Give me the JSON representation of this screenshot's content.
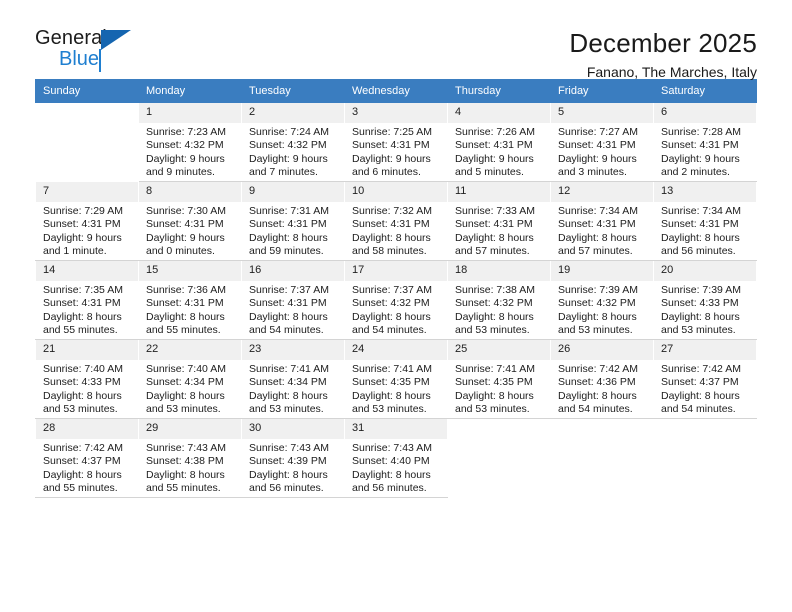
{
  "brand": {
    "name_top": "General",
    "name_bottom": "Blue",
    "accent_color": "#1f7fd0",
    "triangle_color": "#1565b0"
  },
  "header": {
    "title": "December 2025",
    "subtitle": "Fanano, The Marches, Italy"
  },
  "calendar": {
    "header_bg": "#3a7dc0",
    "header_text_color": "#ffffff",
    "daynum_bg": "#f0f0f0",
    "weekday_headers": [
      "Sunday",
      "Monday",
      "Tuesday",
      "Wednesday",
      "Thursday",
      "Friday",
      "Saturday"
    ],
    "weeks": [
      [
        {
          "day": "",
          "lines": []
        },
        {
          "day": "1",
          "lines": [
            "Sunrise: 7:23 AM",
            "Sunset: 4:32 PM",
            "Daylight: 9 hours",
            "and 9 minutes."
          ]
        },
        {
          "day": "2",
          "lines": [
            "Sunrise: 7:24 AM",
            "Sunset: 4:32 PM",
            "Daylight: 9 hours",
            "and 7 minutes."
          ]
        },
        {
          "day": "3",
          "lines": [
            "Sunrise: 7:25 AM",
            "Sunset: 4:31 PM",
            "Daylight: 9 hours",
            "and 6 minutes."
          ]
        },
        {
          "day": "4",
          "lines": [
            "Sunrise: 7:26 AM",
            "Sunset: 4:31 PM",
            "Daylight: 9 hours",
            "and 5 minutes."
          ]
        },
        {
          "day": "5",
          "lines": [
            "Sunrise: 7:27 AM",
            "Sunset: 4:31 PM",
            "Daylight: 9 hours",
            "and 3 minutes."
          ]
        },
        {
          "day": "6",
          "lines": [
            "Sunrise: 7:28 AM",
            "Sunset: 4:31 PM",
            "Daylight: 9 hours",
            "and 2 minutes."
          ]
        }
      ],
      [
        {
          "day": "7",
          "lines": [
            "Sunrise: 7:29 AM",
            "Sunset: 4:31 PM",
            "Daylight: 9 hours",
            "and 1 minute."
          ]
        },
        {
          "day": "8",
          "lines": [
            "Sunrise: 7:30 AM",
            "Sunset: 4:31 PM",
            "Daylight: 9 hours",
            "and 0 minutes."
          ]
        },
        {
          "day": "9",
          "lines": [
            "Sunrise: 7:31 AM",
            "Sunset: 4:31 PM",
            "Daylight: 8 hours",
            "and 59 minutes."
          ]
        },
        {
          "day": "10",
          "lines": [
            "Sunrise: 7:32 AM",
            "Sunset: 4:31 PM",
            "Daylight: 8 hours",
            "and 58 minutes."
          ]
        },
        {
          "day": "11",
          "lines": [
            "Sunrise: 7:33 AM",
            "Sunset: 4:31 PM",
            "Daylight: 8 hours",
            "and 57 minutes."
          ]
        },
        {
          "day": "12",
          "lines": [
            "Sunrise: 7:34 AM",
            "Sunset: 4:31 PM",
            "Daylight: 8 hours",
            "and 57 minutes."
          ]
        },
        {
          "day": "13",
          "lines": [
            "Sunrise: 7:34 AM",
            "Sunset: 4:31 PM",
            "Daylight: 8 hours",
            "and 56 minutes."
          ]
        }
      ],
      [
        {
          "day": "14",
          "lines": [
            "Sunrise: 7:35 AM",
            "Sunset: 4:31 PM",
            "Daylight: 8 hours",
            "and 55 minutes."
          ]
        },
        {
          "day": "15",
          "lines": [
            "Sunrise: 7:36 AM",
            "Sunset: 4:31 PM",
            "Daylight: 8 hours",
            "and 55 minutes."
          ]
        },
        {
          "day": "16",
          "lines": [
            "Sunrise: 7:37 AM",
            "Sunset: 4:31 PM",
            "Daylight: 8 hours",
            "and 54 minutes."
          ]
        },
        {
          "day": "17",
          "lines": [
            "Sunrise: 7:37 AM",
            "Sunset: 4:32 PM",
            "Daylight: 8 hours",
            "and 54 minutes."
          ]
        },
        {
          "day": "18",
          "lines": [
            "Sunrise: 7:38 AM",
            "Sunset: 4:32 PM",
            "Daylight: 8 hours",
            "and 53 minutes."
          ]
        },
        {
          "day": "19",
          "lines": [
            "Sunrise: 7:39 AM",
            "Sunset: 4:32 PM",
            "Daylight: 8 hours",
            "and 53 minutes."
          ]
        },
        {
          "day": "20",
          "lines": [
            "Sunrise: 7:39 AM",
            "Sunset: 4:33 PM",
            "Daylight: 8 hours",
            "and 53 minutes."
          ]
        }
      ],
      [
        {
          "day": "21",
          "lines": [
            "Sunrise: 7:40 AM",
            "Sunset: 4:33 PM",
            "Daylight: 8 hours",
            "and 53 minutes."
          ]
        },
        {
          "day": "22",
          "lines": [
            "Sunrise: 7:40 AM",
            "Sunset: 4:34 PM",
            "Daylight: 8 hours",
            "and 53 minutes."
          ]
        },
        {
          "day": "23",
          "lines": [
            "Sunrise: 7:41 AM",
            "Sunset: 4:34 PM",
            "Daylight: 8 hours",
            "and 53 minutes."
          ]
        },
        {
          "day": "24",
          "lines": [
            "Sunrise: 7:41 AM",
            "Sunset: 4:35 PM",
            "Daylight: 8 hours",
            "and 53 minutes."
          ]
        },
        {
          "day": "25",
          "lines": [
            "Sunrise: 7:41 AM",
            "Sunset: 4:35 PM",
            "Daylight: 8 hours",
            "and 53 minutes."
          ]
        },
        {
          "day": "26",
          "lines": [
            "Sunrise: 7:42 AM",
            "Sunset: 4:36 PM",
            "Daylight: 8 hours",
            "and 54 minutes."
          ]
        },
        {
          "day": "27",
          "lines": [
            "Sunrise: 7:42 AM",
            "Sunset: 4:37 PM",
            "Daylight: 8 hours",
            "and 54 minutes."
          ]
        }
      ],
      [
        {
          "day": "28",
          "lines": [
            "Sunrise: 7:42 AM",
            "Sunset: 4:37 PM",
            "Daylight: 8 hours",
            "and 55 minutes."
          ]
        },
        {
          "day": "29",
          "lines": [
            "Sunrise: 7:43 AM",
            "Sunset: 4:38 PM",
            "Daylight: 8 hours",
            "and 55 minutes."
          ]
        },
        {
          "day": "30",
          "lines": [
            "Sunrise: 7:43 AM",
            "Sunset: 4:39 PM",
            "Daylight: 8 hours",
            "and 56 minutes."
          ]
        },
        {
          "day": "31",
          "lines": [
            "Sunrise: 7:43 AM",
            "Sunset: 4:40 PM",
            "Daylight: 8 hours",
            "and 56 minutes."
          ]
        },
        {
          "day": "",
          "lines": []
        },
        {
          "day": "",
          "lines": []
        },
        {
          "day": "",
          "lines": []
        }
      ]
    ]
  }
}
